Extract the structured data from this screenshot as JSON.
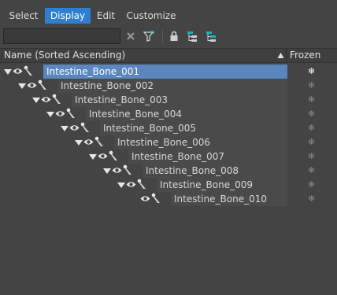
{
  "menu": [
    {
      "label": "Select",
      "active": false
    },
    {
      "label": "Display",
      "active": true
    },
    {
      "label": "Edit",
      "active": false
    },
    {
      "label": "Customize",
      "active": false
    }
  ],
  "toolbar": {
    "search_value": "",
    "icons": [
      "clear-filter-icon",
      "filter-icon",
      "lock-icon",
      "hierarchy-icon",
      "hierarchy-expand-icon"
    ]
  },
  "header": {
    "name_column": "Name (Sorted Ascending)",
    "frozen_column": "Frozen"
  },
  "rows": [
    {
      "label": "Intestine_Bone_001",
      "depth": 0,
      "expanded": true,
      "selected": true,
      "frozen": "❄"
    },
    {
      "label": "Intestine_Bone_002",
      "depth": 1,
      "expanded": true,
      "selected": false,
      "frozen": "❄"
    },
    {
      "label": "Intestine_Bone_003",
      "depth": 2,
      "expanded": true,
      "selected": false,
      "frozen": "❄"
    },
    {
      "label": "Intestine_Bone_004",
      "depth": 3,
      "expanded": true,
      "selected": false,
      "frozen": "❄"
    },
    {
      "label": "Intestine_Bone_005",
      "depth": 4,
      "expanded": true,
      "selected": false,
      "frozen": "❄"
    },
    {
      "label": "Intestine_Bone_006",
      "depth": 5,
      "expanded": true,
      "selected": false,
      "frozen": "❄"
    },
    {
      "label": "Intestine_Bone_007",
      "depth": 6,
      "expanded": true,
      "selected": false,
      "frozen": "❄"
    },
    {
      "label": "Intestine_Bone_008",
      "depth": 7,
      "expanded": true,
      "selected": false,
      "frozen": "❄"
    },
    {
      "label": "Intestine_Bone_009",
      "depth": 8,
      "expanded": true,
      "selected": false,
      "frozen": "❄"
    },
    {
      "label": "Intestine_Bone_010",
      "depth": 9,
      "expanded": false,
      "selected": false,
      "frozen": "❄"
    }
  ],
  "colors": {
    "background": "#444444",
    "menu_active": "#2f7fd1",
    "selected_row": "#5b86bf",
    "accent_cyan": "#19b3b3"
  }
}
